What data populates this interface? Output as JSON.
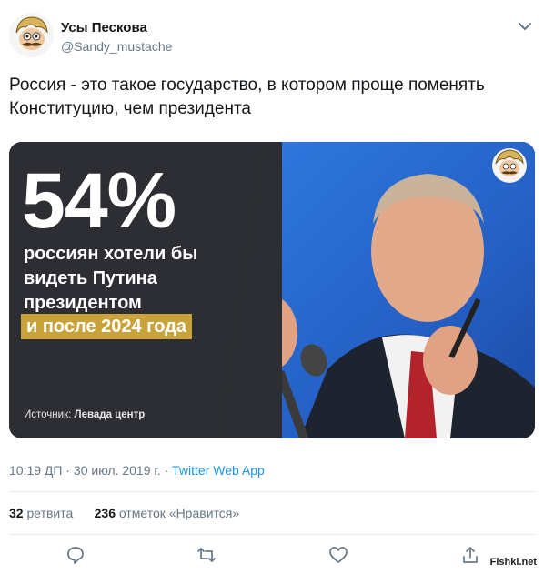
{
  "author": {
    "name": "Усы Пескова",
    "handle": "@Sandy_mustache"
  },
  "tweet": {
    "text": "Россия - это такое государство, в котором проще поменять Конституцию, чем президента"
  },
  "media": {
    "big_number": "54%",
    "line1": "россиян хотели бы",
    "line2": "видеть Путина",
    "line3": "президентом",
    "highlight": "и после 2024 года",
    "source_label": "Источник:",
    "source_value": "Левада центр"
  },
  "meta": {
    "time": "10:19 ДП",
    "separator": "·",
    "date": "30 июл. 2019 г.",
    "app": "Twitter Web App"
  },
  "stats": {
    "retweets_count": "32",
    "retweets_label": "ретвита",
    "likes_count": "236",
    "likes_label": "отметок «Нравится»"
  },
  "actions": [
    "reply-icon",
    "retweet-icon",
    "like-icon",
    "share-icon"
  ],
  "watermark": "Fishki.net",
  "colors": {
    "link": "#1b95e0",
    "muted": "#657786",
    "highlight_bar": "#c9a23a",
    "panel": "#2c2e33",
    "photo_bg": "#2b6fd6"
  }
}
